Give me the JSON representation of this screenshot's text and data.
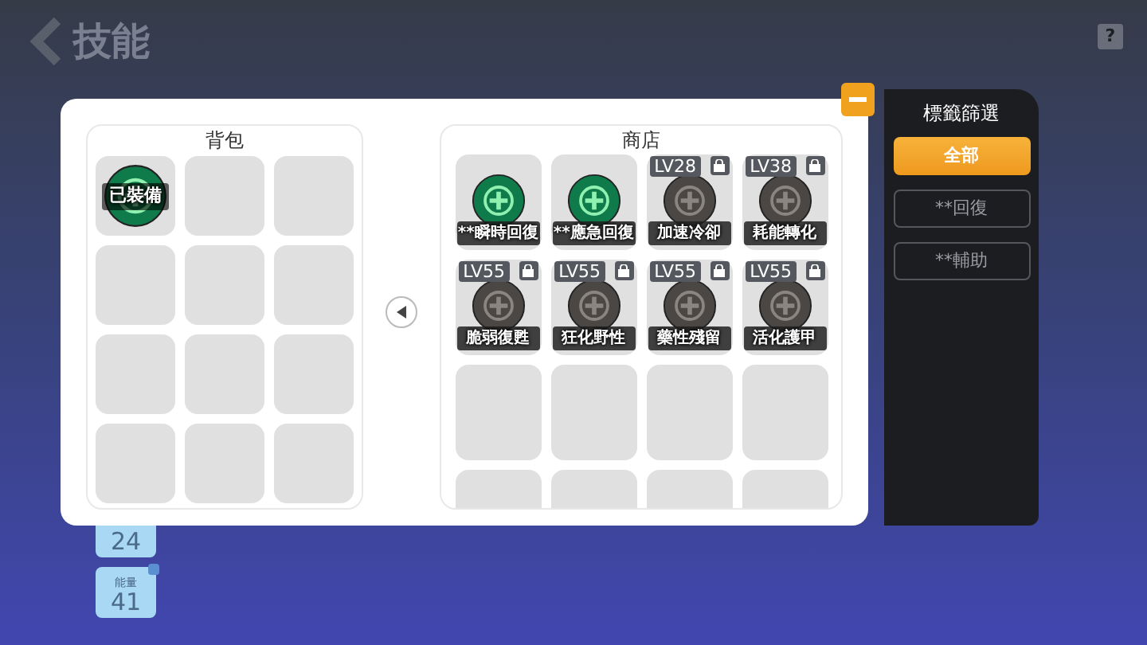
{
  "header": {
    "title": "技能",
    "help": "?"
  },
  "backpack": {
    "title": "背包",
    "slots": [
      {
        "kind": "skill",
        "badge": "已裝備"
      },
      {
        "kind": "empty"
      },
      {
        "kind": "empty"
      },
      {
        "kind": "empty"
      },
      {
        "kind": "empty"
      },
      {
        "kind": "empty"
      },
      {
        "kind": "empty"
      },
      {
        "kind": "empty"
      },
      {
        "kind": "empty"
      },
      {
        "kind": "empty"
      },
      {
        "kind": "empty"
      },
      {
        "kind": "empty"
      }
    ]
  },
  "shop": {
    "title": "商店",
    "items": [
      {
        "kind": "skill",
        "name": "**瞬時回復",
        "locked": false
      },
      {
        "kind": "skill",
        "name": "**應急回復",
        "locked": false
      },
      {
        "kind": "skill",
        "name": "加速冷卻",
        "level": "LV28",
        "locked": true
      },
      {
        "kind": "skill",
        "name": "耗能轉化",
        "level": "LV38",
        "locked": true
      },
      {
        "kind": "skill",
        "name": "脆弱復甦",
        "level": "LV55",
        "locked": true
      },
      {
        "kind": "skill",
        "name": "狂化野性",
        "level": "LV55",
        "locked": true
      },
      {
        "kind": "skill",
        "name": "藥性殘留",
        "level": "LV55",
        "locked": true
      },
      {
        "kind": "skill",
        "name": "活化護甲",
        "level": "LV55",
        "locked": true
      },
      {
        "kind": "empty"
      },
      {
        "kind": "empty"
      },
      {
        "kind": "empty"
      },
      {
        "kind": "empty"
      },
      {
        "kind": "empty"
      },
      {
        "kind": "empty"
      },
      {
        "kind": "empty"
      },
      {
        "kind": "empty"
      }
    ]
  },
  "filter": {
    "title": "標籤篩選",
    "options": [
      {
        "label": "全部",
        "selected": true
      },
      {
        "label": "**回復",
        "selected": false
      },
      {
        "label": "**輔助",
        "selected": false
      }
    ]
  },
  "side_cards": [
    {
      "value": "24"
    },
    {
      "label": "能量",
      "value": "41"
    }
  ]
}
